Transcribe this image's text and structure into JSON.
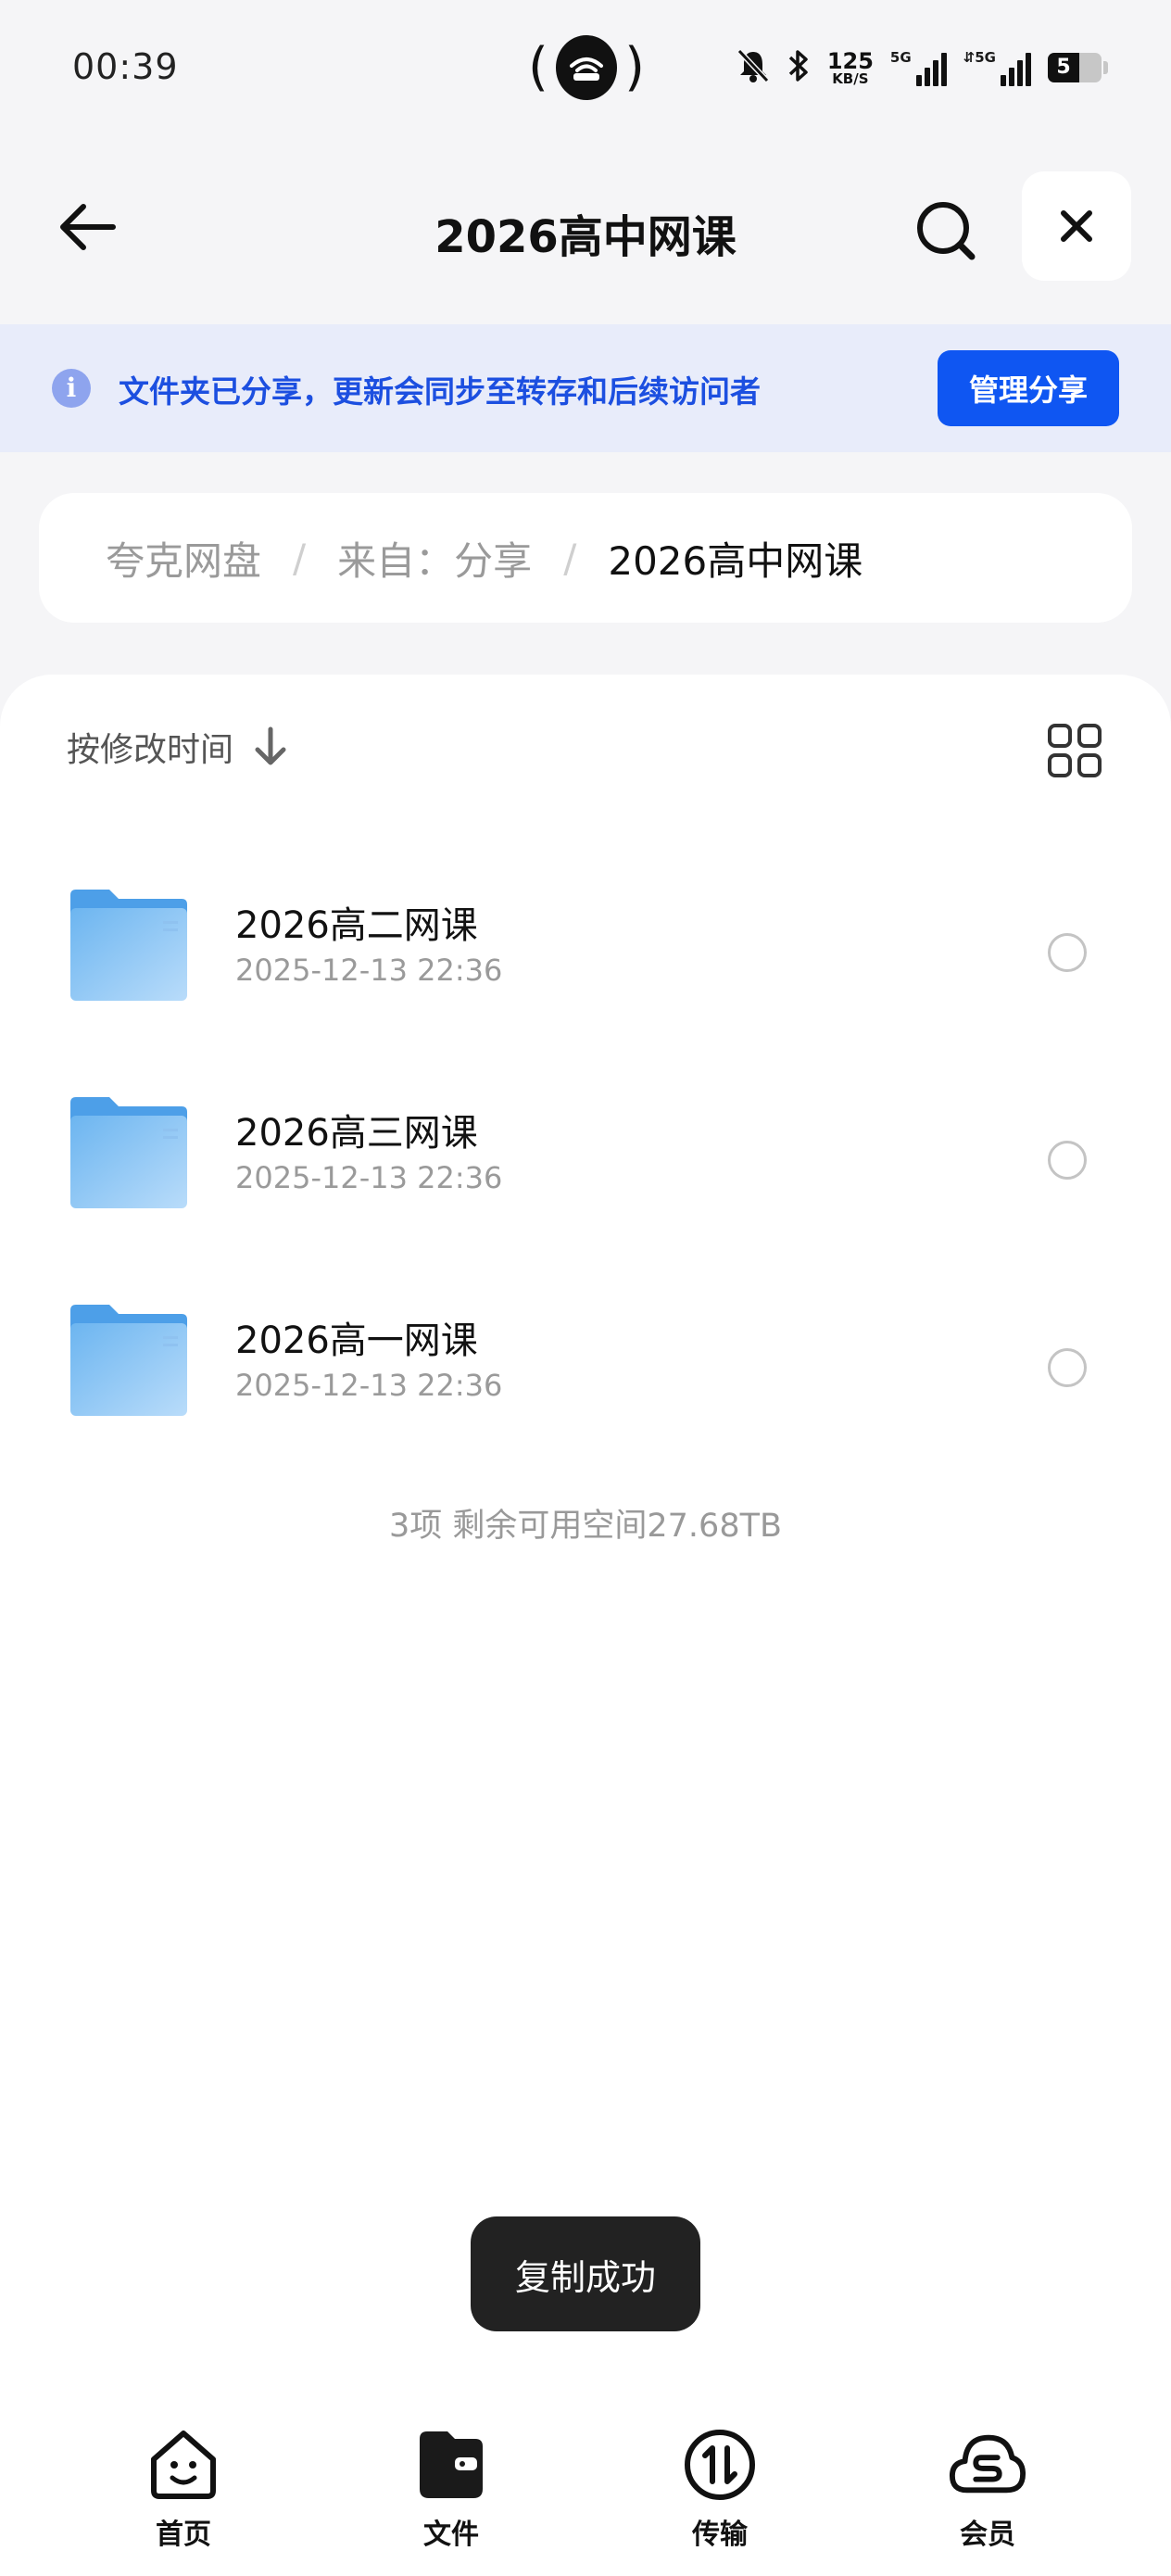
{
  "status_bar": {
    "time": "00:39",
    "net_speed": "125",
    "net_speed_unit": "KB/S",
    "sim1_tag": "5G",
    "sim2_tag": "⇵5G",
    "battery": "5"
  },
  "header": {
    "title": "2026高中网课"
  },
  "share_banner": {
    "info_icon": "i",
    "text": "文件夹已分享，更新会同步至转存和后续访问者",
    "manage_label": "管理分享"
  },
  "breadcrumb": {
    "items": [
      "夸克网盘",
      "来自：分享"
    ],
    "separator": "/",
    "current": "2026高中网课"
  },
  "sort": {
    "label": "按修改时间"
  },
  "files": [
    {
      "name": "2026高二网课",
      "date": "2025-12-13 22:36"
    },
    {
      "name": "2026高三网课",
      "date": "2025-12-13 22:36"
    },
    {
      "name": "2026高一网课",
      "date": "2025-12-13 22:36"
    }
  ],
  "summary": "3项 剩余可用空间27.68TB",
  "toast": "复制成功",
  "nav": {
    "items": [
      {
        "label": "首页",
        "icon": "home-smile-icon"
      },
      {
        "label": "文件",
        "icon": "wallet-folder-icon"
      },
      {
        "label": "传输",
        "icon": "transfer-icon"
      },
      {
        "label": "会员",
        "icon": "cloud-s-icon"
      }
    ]
  },
  "colors": {
    "accent": "#0f56f2",
    "banner_bg": "#e8ecfa",
    "banner_text": "#1c4fe0",
    "folder": "#5aa9ec"
  }
}
